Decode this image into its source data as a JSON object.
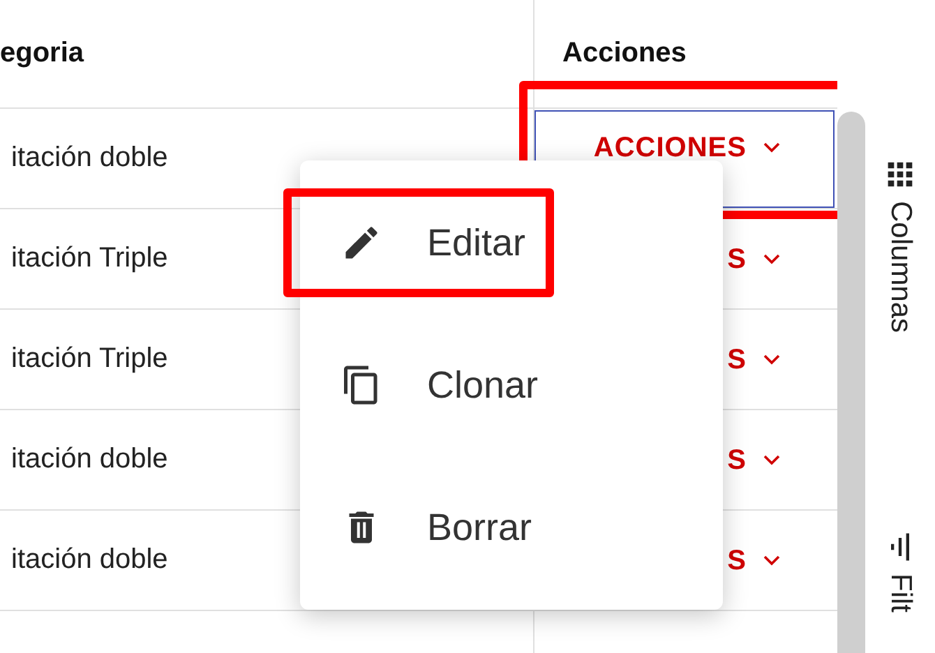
{
  "table": {
    "columns": [
      {
        "label": "egoria"
      },
      {
        "label": "Acciones"
      }
    ],
    "rows": [
      {
        "category": "itación doble",
        "action": {
          "label": "ACCIONES",
          "focused": true,
          "highlighted": true
        }
      },
      {
        "category": "itación Triple",
        "action": {
          "label": "S",
          "focused": false,
          "highlighted": false
        }
      },
      {
        "category": "itación Triple",
        "action": {
          "label": "S",
          "focused": false,
          "highlighted": false
        }
      },
      {
        "category": "itación doble",
        "action": {
          "label": "S",
          "focused": false,
          "highlighted": false
        }
      },
      {
        "category": "itación doble",
        "action": {
          "label": "S",
          "focused": false,
          "highlighted": false
        }
      }
    ]
  },
  "action_menu": {
    "items": [
      {
        "label": "Editar",
        "highlighted": true
      },
      {
        "label": "Clonar",
        "highlighted": false
      },
      {
        "label": "Borrar",
        "highlighted": false
      }
    ]
  },
  "side_panel": {
    "tabs": [
      {
        "label": "Columnas"
      },
      {
        "label": "Filt"
      }
    ]
  }
}
